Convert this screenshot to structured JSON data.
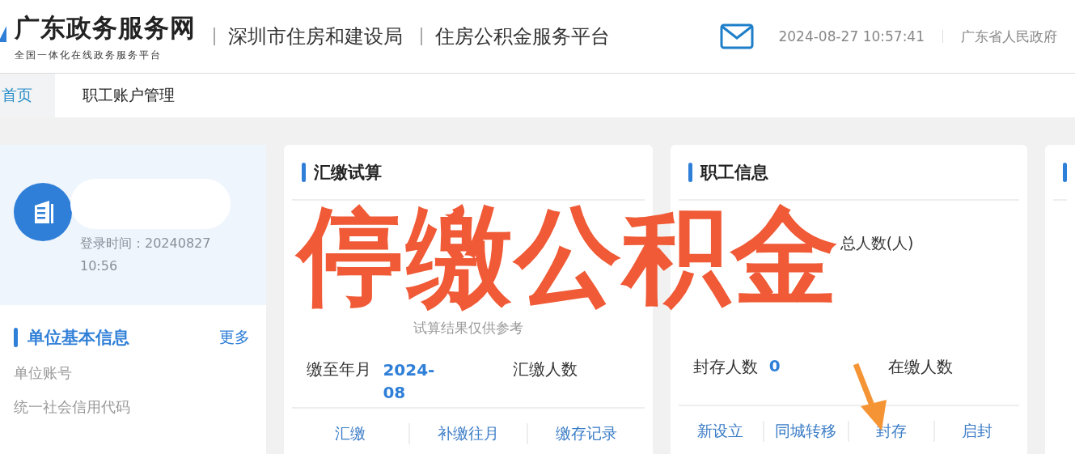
{
  "header": {
    "logo_title": "广东政务服务网",
    "logo_subtitle": "全国一体化在线政务服务平台",
    "agency": "深圳市住房和建设局",
    "platform": "住房公积金服务平台",
    "datetime": "2024-08-27 10:57:41",
    "gov_link": "广东省人民政府"
  },
  "nav": [
    {
      "label": "首页",
      "selected": true
    },
    {
      "label": "职工账户管理",
      "selected": false
    }
  ],
  "profile": {
    "login_time": "登录时间：20240827 10:56"
  },
  "unit_info": {
    "title": "单位基本信息",
    "more": "更多",
    "fields": [
      "单位账号",
      "统一社会信用代码"
    ]
  },
  "calc_card": {
    "title": "汇缴试算",
    "note": "试算结果仅供参考",
    "paid_to_label": "缴至年月",
    "paid_to_value": "2024-08",
    "count_label": "汇缴人数",
    "actions": [
      "汇缴",
      "补缴往月",
      "缴存记录"
    ]
  },
  "staff_card": {
    "title": "职工信息",
    "total_label": "总人数(人)",
    "sealed_label": "封存人数",
    "sealed_value": "0",
    "active_label": "在缴人数",
    "actions": [
      "新设立",
      "同城转移",
      "封存",
      "启封"
    ]
  },
  "annotation": {
    "text": "停缴公积金"
  }
}
